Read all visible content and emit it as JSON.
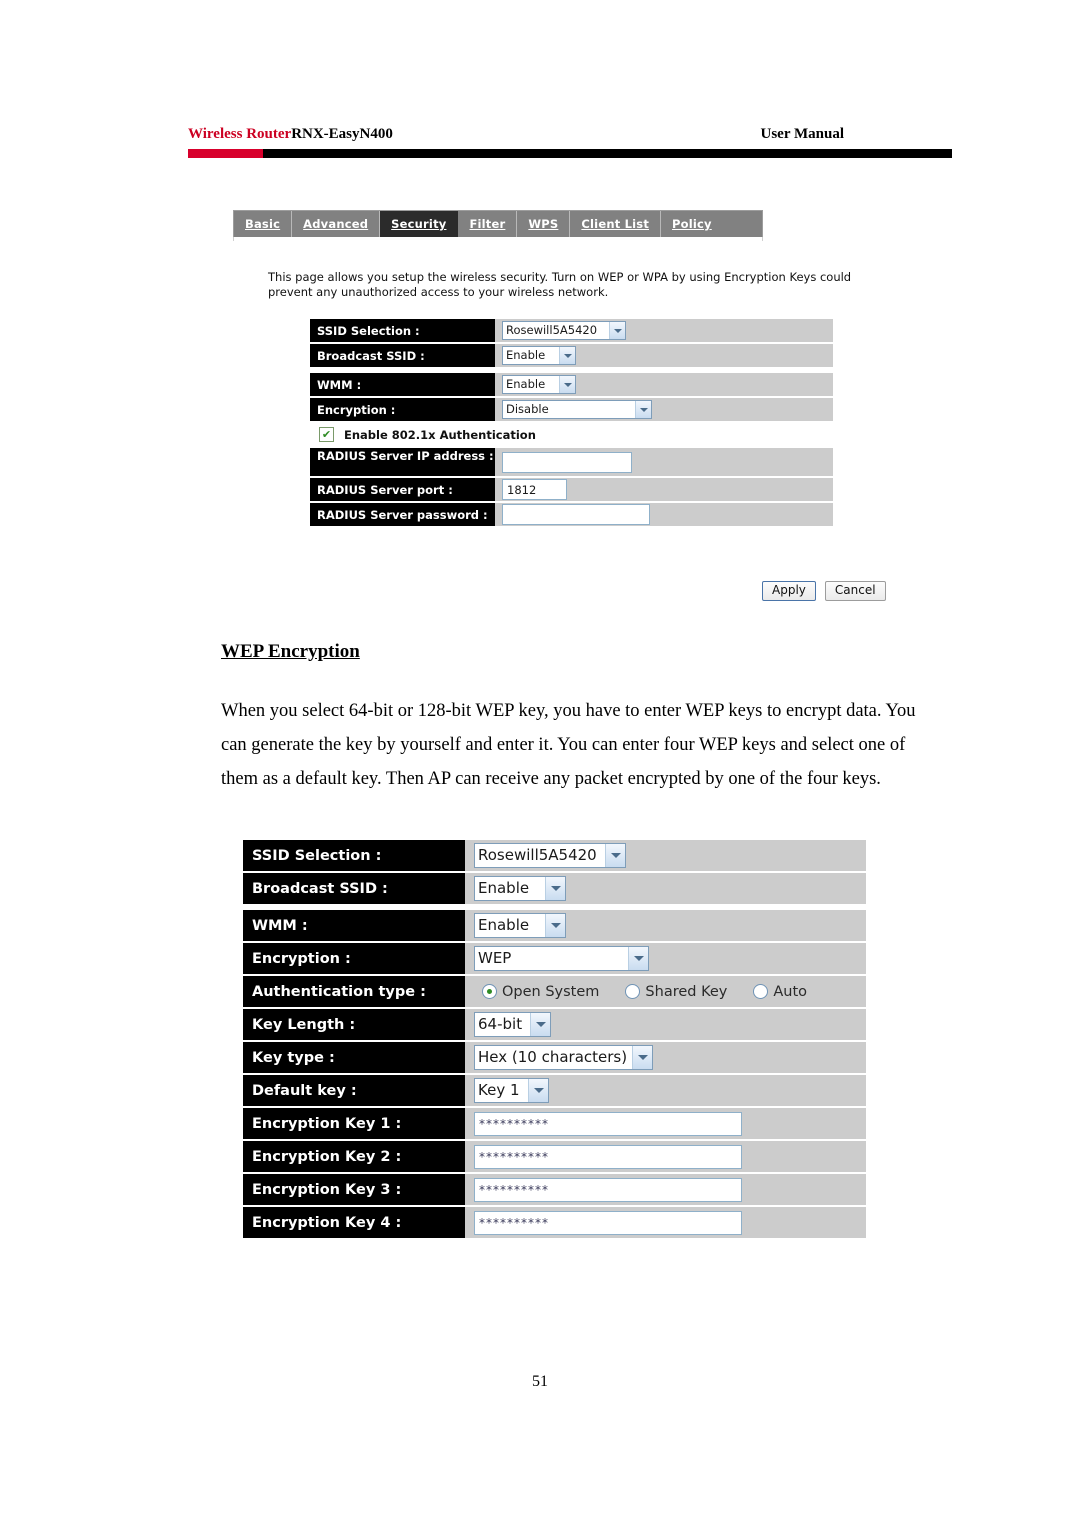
{
  "header": {
    "brand": "Wireless Router",
    "model": "RNX-EasyN400",
    "doc_type": "User Manual",
    "accent_red": "#d8002c",
    "rule_black": "#000000"
  },
  "tabs": [
    {
      "label": "Basic",
      "active": false
    },
    {
      "label": "Advanced",
      "active": false
    },
    {
      "label": "Security",
      "active": true
    },
    {
      "label": "Filter",
      "active": false
    },
    {
      "label": "WPS",
      "active": false
    },
    {
      "label": "Client List",
      "active": false
    },
    {
      "label": "Policy",
      "active": false
    }
  ],
  "intro": "This page allows you setup the wireless security. Turn on WEP or WPA by using Encryption Keys could prevent any unauthorized access to your wireless network.",
  "panel1": {
    "ssid_selection_label": "SSID Selection :",
    "ssid_selection_value": "Rosewill5A5420",
    "broadcast_ssid_label": "Broadcast SSID :",
    "broadcast_ssid_value": "Enable",
    "wmm_label": "WMM :",
    "wmm_value": "Enable",
    "encryption_label": "Encryption :",
    "encryption_value": "Disable",
    "dot1x_label": "Enable 802.1x Authentication",
    "dot1x_checked": "checked",
    "radius_ip_label": "RADIUS Server IP address :",
    "radius_ip_value": "",
    "radius_port_label": "RADIUS Server port :",
    "radius_port_value": "1812",
    "radius_password_label": "RADIUS Server password :",
    "radius_password_value": ""
  },
  "buttons": {
    "apply": "Apply",
    "cancel": "Cancel"
  },
  "section": {
    "heading": "WEP Encryption",
    "body": "When you select 64-bit or 128-bit WEP key, you have to enter WEP keys to encrypt data. You can generate the key by yourself and enter it. You can enter four WEP keys and select one of them as a default key. Then AP can receive any packet encrypted by one of the four keys."
  },
  "panel2": {
    "ssid_selection_label": "SSID Selection :",
    "ssid_selection_value": "Rosewill5A5420",
    "broadcast_ssid_label": "Broadcast SSID :",
    "broadcast_ssid_value": "Enable",
    "wmm_label": "WMM :",
    "wmm_value": "Enable",
    "encryption_label": "Encryption :",
    "encryption_value": "WEP",
    "auth_type_label": "Authentication type :",
    "auth_options": [
      {
        "label": "Open System",
        "selected": true
      },
      {
        "label": "Shared Key",
        "selected": false
      },
      {
        "label": "Auto",
        "selected": false
      }
    ],
    "key_length_label": "Key Length :",
    "key_length_value": "64-bit",
    "key_type_label": "Key type :",
    "key_type_value": "Hex (10 characters)",
    "default_key_label": "Default key :",
    "default_key_value": "Key 1",
    "enc_key1_label": "Encryption Key 1 :",
    "enc_key1_value": "**********",
    "enc_key2_label": "Encryption Key 2 :",
    "enc_key2_value": "**********",
    "enc_key3_label": "Encryption Key 3 :",
    "enc_key3_value": "**********",
    "enc_key4_label": "Encryption Key 4 :",
    "enc_key4_value": "**********"
  },
  "page_number": "51"
}
